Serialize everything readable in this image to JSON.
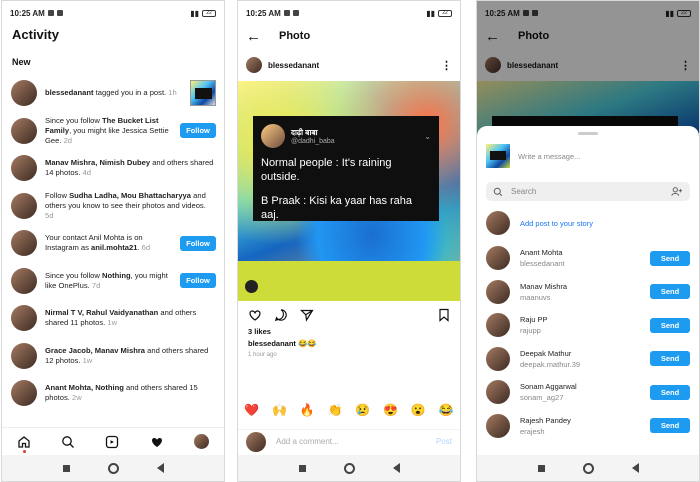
{
  "status": {
    "time": "10:25 AM",
    "battery": "22"
  },
  "activity": {
    "title": "Activity",
    "section_new": "New",
    "rows": [
      {
        "pre": "",
        "bold": "blessedanant",
        "rest": " tagged you in a post.",
        "time": " 1h",
        "action": "thumb",
        "action_label": ""
      },
      {
        "pre": "Since you follow ",
        "bold": "The Bucket List Family",
        "rest": ", you might like Jessica Settie Gee.",
        "time": " 2d",
        "action": "follow",
        "action_label": "Follow"
      },
      {
        "pre": "",
        "bold": "Manav Mishra, Nimish Dubey",
        "rest": " and others shared 14 photos.",
        "time": " 4d",
        "action": "none",
        "action_label": ""
      },
      {
        "pre": "Follow ",
        "bold": "Sudha Ladha, Mou Bhattacharyya",
        "rest": " and others you know to see their photos and videos.",
        "time": " 5d",
        "action": "none",
        "action_label": ""
      },
      {
        "pre": "Your contact Anil Mohta is on Instagram as ",
        "bold": "anil.mohta21",
        "rest": ".",
        "time": " 6d",
        "action": "follow",
        "action_label": "Follow"
      },
      {
        "pre": "Since you follow ",
        "bold": "Nothing",
        "rest": ", you might like OnePlus.",
        "time": " 7d",
        "action": "follow",
        "action_label": "Follow"
      },
      {
        "pre": "",
        "bold": "Nirmal T V, Rahul Vaidyanathan",
        "rest": " and others shared 11 photos.",
        "time": " 1w",
        "action": "none",
        "action_label": ""
      },
      {
        "pre": "",
        "bold": "Grace Jacob, Manav Mishra",
        "rest": " and others shared 12 photos.",
        "time": " 1w",
        "action": "none",
        "action_label": ""
      },
      {
        "pre": "",
        "bold": "Anant Mohta, Nothing",
        "rest": " and others shared 15 photos.",
        "time": " 2w",
        "action": "none",
        "action_label": ""
      }
    ]
  },
  "photo": {
    "title": "Photo",
    "username": "blessedanant",
    "tweet": {
      "name": "दाढ़ी बाबा",
      "handle": "@dadhi_baba",
      "line1": "Normal people : It's raining outside.",
      "line2": "B Praak : Kisi ka yaar has raha aaj."
    },
    "likes": "3 likes",
    "caption": "blessedanant 😂😂",
    "posted": "1 hour ago",
    "emojis": [
      "❤️",
      "🙌",
      "🔥",
      "👏",
      "😢",
      "😍",
      "😮",
      "😂"
    ],
    "comment_placeholder": "Add a comment...",
    "post_label": "Post"
  },
  "share": {
    "title": "Photo",
    "username": "blessedanant",
    "message_placeholder": "Write a message...",
    "search_placeholder": "Search",
    "story_label": "Add post to your story",
    "send_label": "Send",
    "contacts": [
      {
        "name": "Anant Mohta",
        "user": "blessedanant"
      },
      {
        "name": "Manav Mishra",
        "user": "maanuvs"
      },
      {
        "name": "Raju PP",
        "user": "rajupp"
      },
      {
        "name": "Deepak Mathur",
        "user": "deepak.mathur.39"
      },
      {
        "name": "Sonam Aggarwal",
        "user": "sonam_ag27"
      },
      {
        "name": "Rajesh Pandey",
        "user": "erajesh"
      }
    ]
  },
  "colors": {
    "accent": "#1d9bf0",
    "link": "#1877f2"
  }
}
